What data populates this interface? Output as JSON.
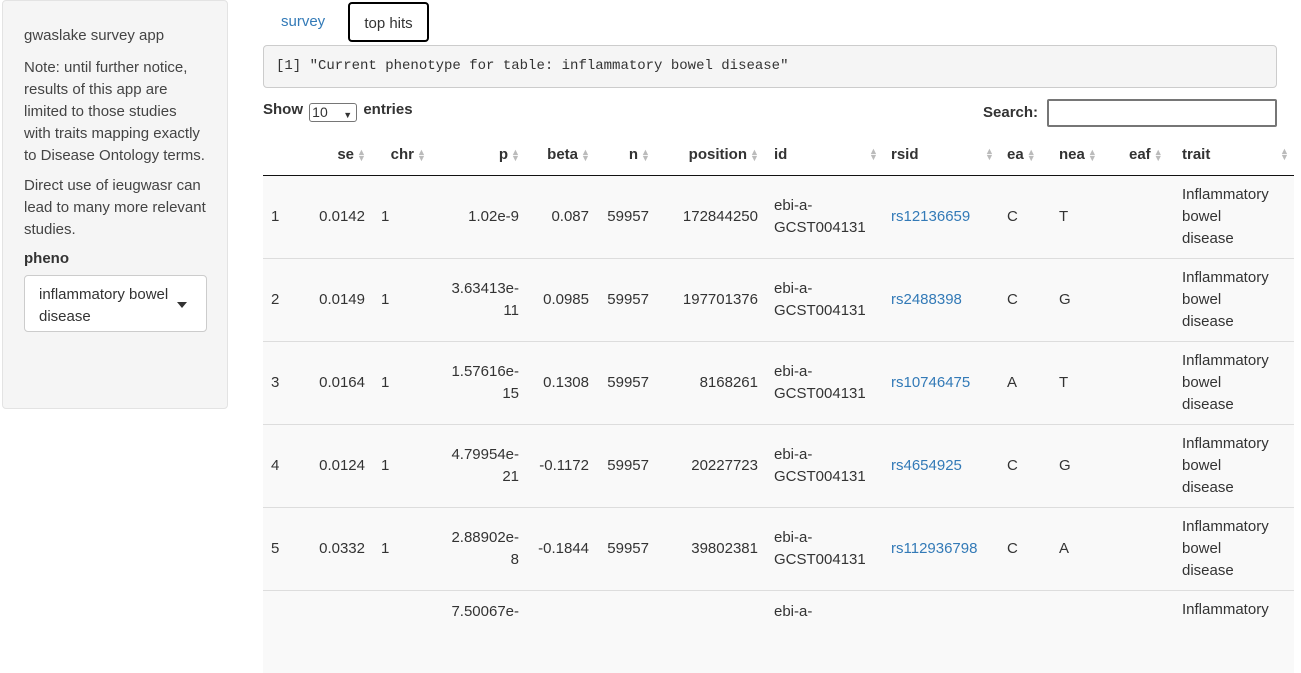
{
  "sidebar": {
    "app_title": "gwaslake survey app",
    "note": "Note: until further notice, results of this app are limited to those studies with traits mapping exactly to Disease Ontology terms.",
    "direct_use": "Direct use of ieugwasr can lead to many more relevant studies.",
    "pheno_label": "pheno",
    "pheno_selected": "inflammatory bowel disease"
  },
  "tabs": [
    {
      "label": "survey",
      "active": false
    },
    {
      "label": "top hits",
      "active": true
    }
  ],
  "output_text": "[1] \"Current phenotype for table: inflammatory bowel disease\"",
  "controls": {
    "show_label": "Show",
    "entries_value": "10",
    "entries_label": "entries",
    "search_label": "Search:",
    "search_value": ""
  },
  "table": {
    "columns": [
      "",
      "se",
      "chr",
      "p",
      "beta",
      "n",
      "position",
      "id",
      "rsid",
      "ea",
      "nea",
      "eaf",
      "trait"
    ],
    "rows": [
      {
        "idx": "1",
        "se": "0.0142",
        "chr": "1",
        "p1": "1.02e-9",
        "p2": "",
        "beta": "0.087",
        "n": "59957",
        "position": "172844250",
        "id1": "ebi-a-",
        "id2": "GCST004131",
        "rsid": "rs12136659",
        "ea": "C",
        "nea": "T",
        "eaf": "",
        "t1": "Inflammatory",
        "t2": "bowel",
        "t3": "disease"
      },
      {
        "idx": "2",
        "se": "0.0149",
        "chr": "1",
        "p1": "3.63413e-",
        "p2": "11",
        "beta": "0.0985",
        "n": "59957",
        "position": "197701376",
        "id1": "ebi-a-",
        "id2": "GCST004131",
        "rsid": "rs2488398",
        "ea": "C",
        "nea": "G",
        "eaf": "",
        "t1": "Inflammatory",
        "t2": "bowel",
        "t3": "disease"
      },
      {
        "idx": "3",
        "se": "0.0164",
        "chr": "1",
        "p1": "1.57616e-",
        "p2": "15",
        "beta": "0.1308",
        "n": "59957",
        "position": "8168261",
        "id1": "ebi-a-",
        "id2": "GCST004131",
        "rsid": "rs10746475",
        "ea": "A",
        "nea": "T",
        "eaf": "",
        "t1": "Inflammatory",
        "t2": "bowel",
        "t3": "disease"
      },
      {
        "idx": "4",
        "se": "0.0124",
        "chr": "1",
        "p1": "4.79954e-",
        "p2": "21",
        "beta": "-0.1172",
        "n": "59957",
        "position": "20227723",
        "id1": "ebi-a-",
        "id2": "GCST004131",
        "rsid": "rs4654925",
        "ea": "C",
        "nea": "G",
        "eaf": "",
        "t1": "Inflammatory",
        "t2": "bowel",
        "t3": "disease"
      },
      {
        "idx": "5",
        "se": "0.0332",
        "chr": "1",
        "p1": "2.88902e-",
        "p2": "8",
        "beta": "-0.1844",
        "n": "59957",
        "position": "39802381",
        "id1": "ebi-a-",
        "id2": "GCST004131",
        "rsid": "rs112936798",
        "ea": "C",
        "nea": "A",
        "eaf": "",
        "t1": "Inflammatory",
        "t2": "bowel",
        "t3": "disease"
      },
      {
        "idx": "",
        "se": "",
        "chr": "",
        "p1": "7.50067e-",
        "p2": "",
        "beta": "",
        "n": "",
        "position": "",
        "id1": "ebi-a-",
        "id2": "",
        "rsid": "",
        "ea": "",
        "nea": "",
        "eaf": "",
        "t1": "Inflammatory",
        "t2": "",
        "t3": ""
      }
    ]
  }
}
